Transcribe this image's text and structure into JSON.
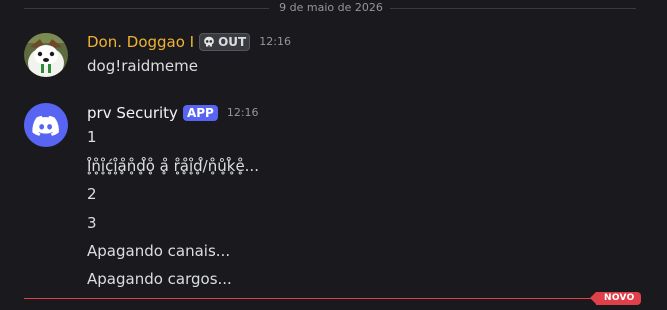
{
  "date_divider": "9 de maio de 2026",
  "messages": [
    {
      "author": "Don. Doggao I",
      "author_color": "#f0b232",
      "tag": "OUT",
      "tag_icon": "skull-icon",
      "time": "12:16",
      "lines": [
        "dog!raidmeme"
      ]
    },
    {
      "author": "prv Security",
      "author_color": "#f2f3f5",
      "tag": "APP",
      "time": "12:16",
      "lines": [
        "1",
        "I̥̊n̥̊i̥̊ć̥i̥̊ḁ̊n̥̊d̥̊o̥̊ ḁ̊ r̥̊ḁ̊i̥̊d̥̊/n̥̊ů̥k̥̊e̥̊...",
        "2",
        "3",
        "Apagando canais...",
        "Apagando cargos..."
      ]
    }
  ],
  "new_badge": "NOVO",
  "colors": {
    "background": "#1a1a1e",
    "accent_app": "#5865f2",
    "new_line": "#e0404a"
  }
}
